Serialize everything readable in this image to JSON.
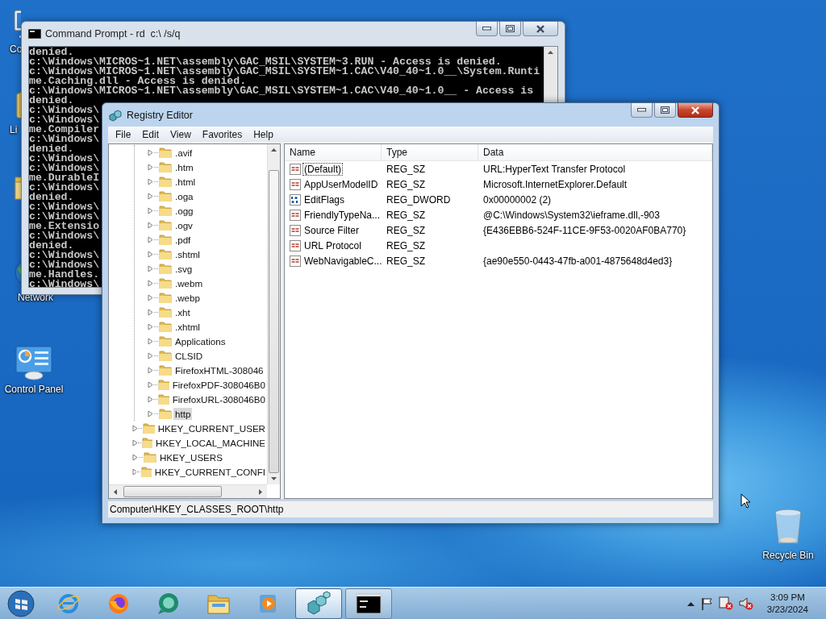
{
  "desktop_icons": [
    {
      "kind": "computer",
      "label": "Co"
    },
    {
      "kind": "libraries",
      "label": "Li"
    },
    {
      "kind": "folder"
    },
    {
      "kind": "network",
      "label": "Network"
    },
    {
      "kind": "control_panel",
      "label": "Control Panel"
    },
    {
      "kind": "recycle_bin",
      "label": "Recycle Bin"
    }
  ],
  "command_prompt": {
    "title": "Command Prompt - rd  c:\\ /s/q",
    "active": false,
    "lines": [
      "denied.",
      "c:\\Windows\\MICROS~1.NET\\assembly\\GAC_MSIL\\SYSTEM~3.RUN - Access is denied.",
      "c:\\Windows\\MICROS~1.NET\\assembly\\GAC_MSIL\\SYSTEM~1.CAC\\V40_40~1.0__\\System.Runti",
      "me.Caching.dll - Access is denied.",
      "c:\\Windows\\MICROS~1.NET\\assembly\\GAC_MSIL\\SYSTEM~1.CAC\\V40_40~1.0__ - Access is",
      "denied.",
      "c:\\Windows\\",
      "c:\\Windows\\",
      "me.Compiler",
      "c:\\Windows\\",
      "denied.",
      "c:\\Windows\\",
      "c:\\Windows\\",
      "me.DurableI",
      "c:\\Windows\\",
      "denied.",
      "c:\\Windows\\",
      "c:\\Windows\\",
      "me.Extensio",
      "c:\\Windows\\",
      "denied.",
      "c:\\Windows\\",
      "c:\\Windows\\",
      "me.Handles.",
      "c:\\Windows\\"
    ]
  },
  "registry_editor": {
    "title": "Registry Editor",
    "active": true,
    "menu": [
      "File",
      "Edit",
      "View",
      "Favorites",
      "Help"
    ],
    "tree": {
      "branch": [
        {
          "label": ".avif",
          "selected": false
        },
        {
          "label": ".htm",
          "selected": false
        },
        {
          "label": ".html",
          "selected": false
        },
        {
          "label": ".oga",
          "selected": false
        },
        {
          "label": ".ogg",
          "selected": false
        },
        {
          "label": ".ogv",
          "selected": false
        },
        {
          "label": ".pdf",
          "selected": false
        },
        {
          "label": ".shtml",
          "selected": false
        },
        {
          "label": ".svg",
          "selected": false
        },
        {
          "label": ".webm",
          "selected": false
        },
        {
          "label": ".webp",
          "selected": false
        },
        {
          "label": ".xht",
          "selected": false
        },
        {
          "label": ".xhtml",
          "selected": false
        },
        {
          "label": "Applications",
          "selected": false
        },
        {
          "label": "CLSID",
          "selected": false
        },
        {
          "label": "FirefoxHTML-308046",
          "selected": false
        },
        {
          "label": "FirefoxPDF-308046B0",
          "selected": false
        },
        {
          "label": "FirefoxURL-308046B0",
          "selected": false
        },
        {
          "label": "http",
          "selected": true
        }
      ],
      "roots": [
        {
          "label": "HKEY_CURRENT_USER",
          "selected": false
        },
        {
          "label": "HKEY_LOCAL_MACHINE",
          "selected": false
        },
        {
          "label": "HKEY_USERS",
          "selected": false
        },
        {
          "label": "HKEY_CURRENT_CONFI",
          "selected": false
        }
      ]
    },
    "columns": [
      "Name",
      "Type",
      "Data"
    ],
    "values": [
      {
        "kind": "string",
        "name": "(Default)",
        "type": "REG_SZ",
        "data": "URL:HyperText Transfer Protocol",
        "focused": true
      },
      {
        "kind": "string",
        "name": "AppUserModelID",
        "type": "REG_SZ",
        "data": "Microsoft.InternetExplorer.Default",
        "focused": false
      },
      {
        "kind": "dword",
        "name": "EditFlags",
        "type": "REG_DWORD",
        "data": "0x00000002 (2)",
        "focused": false
      },
      {
        "kind": "string",
        "name": "FriendlyTypeNa...",
        "type": "REG_SZ",
        "data": "@C:\\Windows\\System32\\ieframe.dll,-903",
        "focused": false
      },
      {
        "kind": "string",
        "name": "Source Filter",
        "type": "REG_SZ",
        "data": "{E436EBB6-524F-11CE-9F53-0020AF0BA770}",
        "focused": false
      },
      {
        "kind": "string",
        "name": "URL Protocol",
        "type": "REG_SZ",
        "focused": false
      },
      {
        "kind": "string",
        "name": "WebNavigableC...",
        "type": "REG_SZ",
        "data": "{ae90e550-0443-47fb-a001-4875648d4ed3}",
        "focused": false
      }
    ],
    "status_bar": "Computer\\HKEY_CLASSES_ROOT\\http"
  },
  "taskbar": {
    "items": [
      {
        "kind": "ie",
        "open": false,
        "selected": false
      },
      {
        "kind": "firefox",
        "open": false,
        "selected": false
      },
      {
        "kind": "chat",
        "open": false,
        "selected": false
      },
      {
        "kind": "explorer",
        "open": false,
        "selected": false
      },
      {
        "kind": "media",
        "open": false,
        "selected": false
      },
      {
        "kind": "regedit",
        "open": true,
        "selected": true
      },
      {
        "kind": "cmd",
        "open": true,
        "selected": false
      }
    ],
    "clock_time": "3:09 PM",
    "clock_date": "3/23/2024"
  }
}
